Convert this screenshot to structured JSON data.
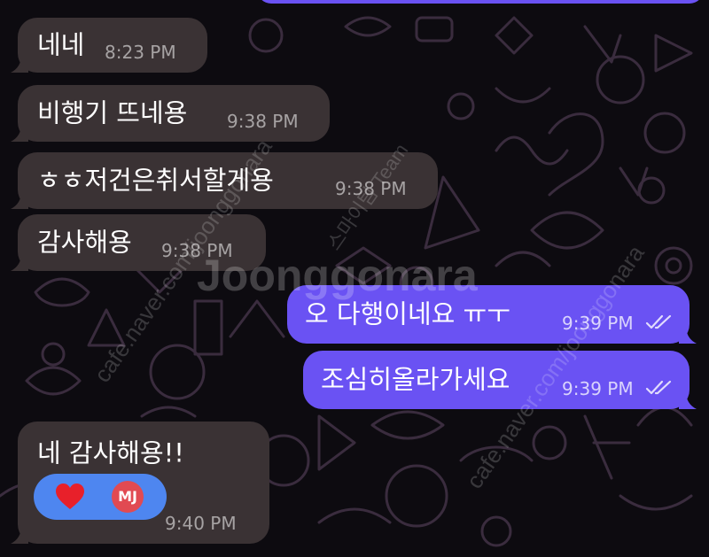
{
  "colors": {
    "background": "#0d0b10",
    "incoming_bubble": "#3a3234",
    "outgoing_bubble": "#6a52f3",
    "reaction_pill": "#4e86f0",
    "heart": "#e8202a",
    "avatar": "#e14a52"
  },
  "messages": [
    {
      "direction": "incoming",
      "text": "네네",
      "time": "8:23 PM"
    },
    {
      "direction": "incoming",
      "text": "비행기 뜨네용",
      "time": "9:38 PM"
    },
    {
      "direction": "incoming",
      "text": "ㅎㅎ저건은취서할게용",
      "time": "9:38 PM"
    },
    {
      "direction": "incoming",
      "text": "감사해용",
      "time": "9:38 PM"
    },
    {
      "direction": "outgoing",
      "text": "오 다행이네요 ㅠㅜ",
      "time": "9:39 PM",
      "status_icon": "double-check-icon"
    },
    {
      "direction": "outgoing",
      "text": "조심히올라가세요",
      "time": "9:39 PM",
      "status_icon": "double-check-icon"
    },
    {
      "direction": "incoming",
      "text": "네 감사해용!!",
      "time": "9:40 PM",
      "reaction": {
        "emoji_icon": "red-heart-icon",
        "avatar_initials": "MJ"
      }
    }
  ],
  "watermark": {
    "brand": "Joonggonara",
    "site": "cafe.naver.com/joonggonara",
    "team": "스마이팀 Team"
  }
}
